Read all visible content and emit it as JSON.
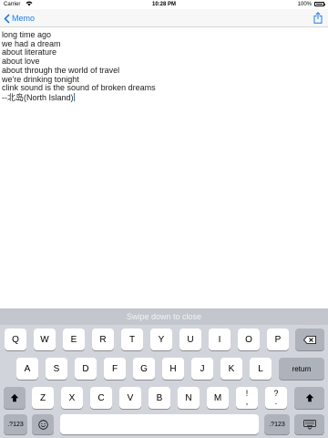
{
  "status_bar": {
    "carrier": "Carrier",
    "time": "10:28 PM",
    "battery": "100%"
  },
  "nav": {
    "back_label": "Memo"
  },
  "editor": {
    "lines": [
      "long time ago",
      "we had a dream",
      "about literature",
      "about love",
      "about through the world of travel",
      "we're drinking tonight",
      "clink sound is the sound of broken dreams",
      "--北岛(North Island)"
    ]
  },
  "keyboard": {
    "hint": "Swipe down to close",
    "row1": [
      "Q",
      "W",
      "E",
      "R",
      "T",
      "Y",
      "U",
      "I",
      "O",
      "P"
    ],
    "row2": [
      "A",
      "S",
      "D",
      "F",
      "G",
      "H",
      "J",
      "K",
      "L"
    ],
    "row3": [
      "Z",
      "X",
      "C",
      "V",
      "B",
      "N",
      "M"
    ],
    "punct1": [
      "!",
      ","
    ],
    "punct2": [
      "?",
      "."
    ],
    "return_label": "return",
    "numbers_label": ".?123"
  }
}
